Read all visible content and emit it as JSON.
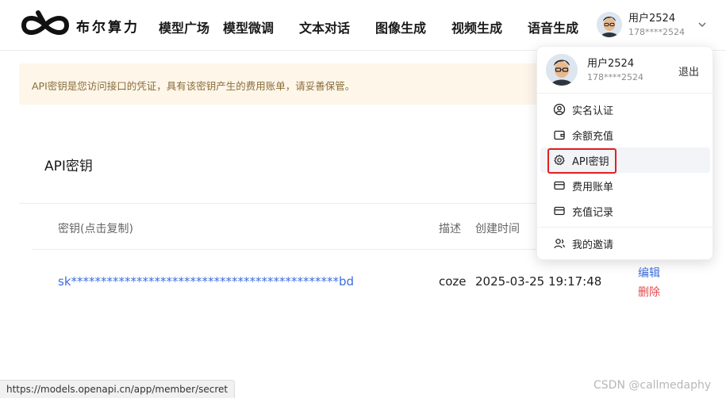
{
  "brand": {
    "name": "布尔算力",
    "logo_icon": "infinity-logo-icon"
  },
  "nav": [
    {
      "label": "模型广场"
    },
    {
      "label": "模型微调"
    },
    {
      "label": "文本对话"
    },
    {
      "label": "图像生成"
    },
    {
      "label": "视频生成"
    },
    {
      "label": "语音生成"
    }
  ],
  "user": {
    "name": "用户2524",
    "phone": "178****2524",
    "avatar_icon": "cartoon-avatar-icon",
    "dropdown_icon": "chevron-down-icon"
  },
  "notice": {
    "text": "API密钥是您访问接口的凭证，具有该密钥产生的费用账单，请妥善保管。"
  },
  "section": {
    "title": "API密钥"
  },
  "table": {
    "headers": {
      "key": "密钥(点击复制)",
      "desc": "描述",
      "created": "创建时间"
    },
    "rows": [
      {
        "key": "sk*********************************************bd",
        "desc": "coze",
        "created": "2025-03-25 19:17:48",
        "edit": "编辑",
        "delete": "删除"
      }
    ]
  },
  "dropdown": {
    "name": "用户2524",
    "phone": "178****2524",
    "logout": "退出",
    "items": [
      {
        "label": "实名认证",
        "icon": "user-circle-icon"
      },
      {
        "label": "余额充值",
        "icon": "wallet-icon"
      },
      {
        "label": "API密钥",
        "icon": "gear-icon",
        "active": true
      },
      {
        "label": "费用账单",
        "icon": "card-icon"
      },
      {
        "label": "充值记录",
        "icon": "card-icon"
      },
      {
        "label": "我的邀请",
        "icon": "users-icon"
      }
    ]
  },
  "status_url": "https://models.openapi.cn/app/member/secret",
  "watermark": "CSDN @callmedaphy",
  "colors": {
    "link": "#3c6ee0",
    "danger": "#e5484d",
    "notice_bg": "#fdf6e9",
    "highlight": "#e02020"
  }
}
